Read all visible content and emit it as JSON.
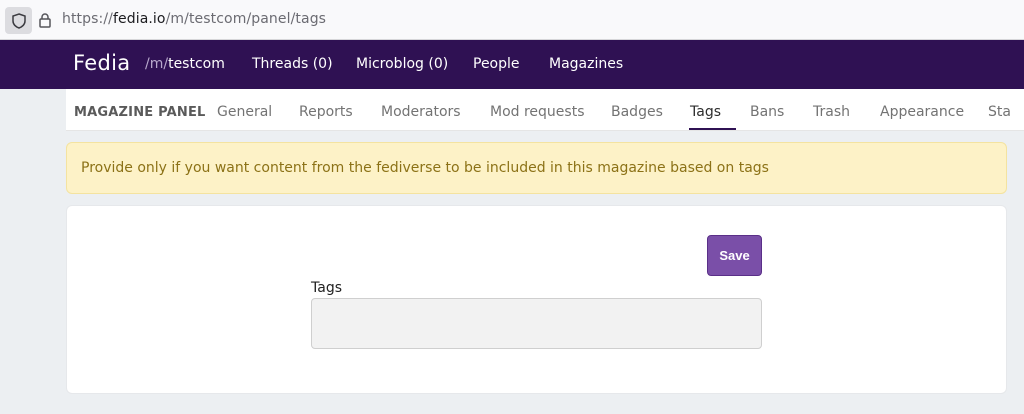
{
  "browser": {
    "url_prefix": "https://",
    "url_host": "fedia.io",
    "url_path": "/m/testcom/panel/tags"
  },
  "header": {
    "brand": "Fedia",
    "magazine_prefix": "/m/",
    "magazine_name": "testcom",
    "nav": [
      "Threads (0)",
      "Microblog (0)",
      "People",
      "Magazines"
    ]
  },
  "panel": {
    "title": "MAGAZINE PANEL",
    "tabs": [
      "General",
      "Reports",
      "Moderators",
      "Mod requests",
      "Badges",
      "Tags",
      "Bans",
      "Trash",
      "Appearance",
      "Sta"
    ],
    "active_tab": "Tags"
  },
  "alert": {
    "text": "Provide only if you want content from the fediverse to be included in this magazine based on tags"
  },
  "form": {
    "save_label": "Save",
    "tags_label": "Tags",
    "tags_value": ""
  },
  "colors": {
    "header_bg": "#2f1153",
    "save_bg": "#7a4fa8",
    "alert_bg": "#fdf2c7",
    "alert_text": "#8c7217"
  }
}
